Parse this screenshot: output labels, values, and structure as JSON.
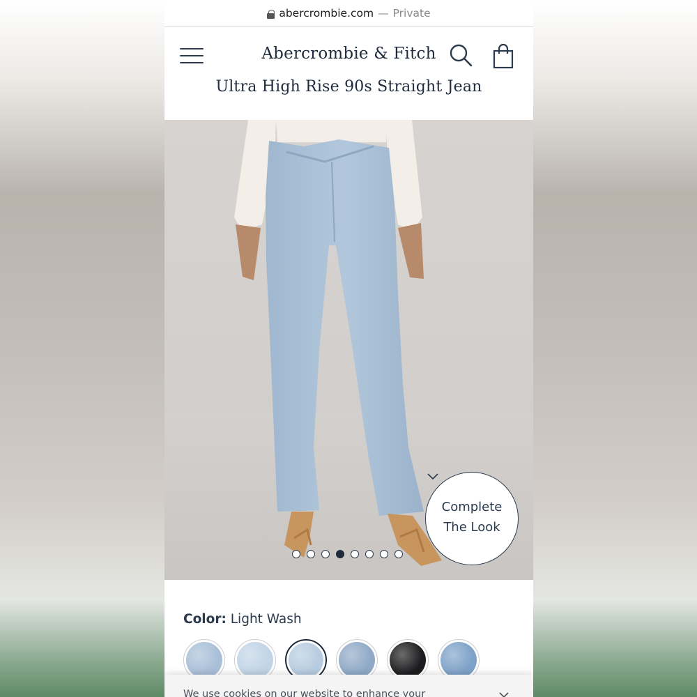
{
  "browser": {
    "domain": "abercrombie.com",
    "separator": "—",
    "mode": "Private"
  },
  "header": {
    "logo": "Abercrombie & Fitch"
  },
  "product": {
    "title": "Ultra High Rise 90s Straight Jean",
    "complete_look_line1": "Complete",
    "complete_look_line2": "The Look",
    "gallery": {
      "image_count": 8,
      "active_index": 3
    },
    "color_label": "Color:",
    "color_value": "Light Wash",
    "swatches": [
      {
        "name": "swatch-1",
        "color": "#a9bfd8",
        "selected": false
      },
      {
        "name": "swatch-2",
        "color": "#c2d4e6",
        "selected": false
      },
      {
        "name": "swatch-3",
        "color": "#b7cce0",
        "selected": true
      },
      {
        "name": "swatch-4",
        "color": "#8fa9c6",
        "selected": false
      },
      {
        "name": "swatch-5",
        "color": "#1d1d1f",
        "selected": false
      },
      {
        "name": "swatch-6",
        "color": "#7ea2c8",
        "selected": false
      }
    ]
  },
  "cookie_banner": {
    "text": "We use cookies on our website to enhance your"
  },
  "colors": {
    "brand_navy": "#1f2b3c",
    "denim": "#a9c0d6",
    "background": "#d4d1ce"
  }
}
